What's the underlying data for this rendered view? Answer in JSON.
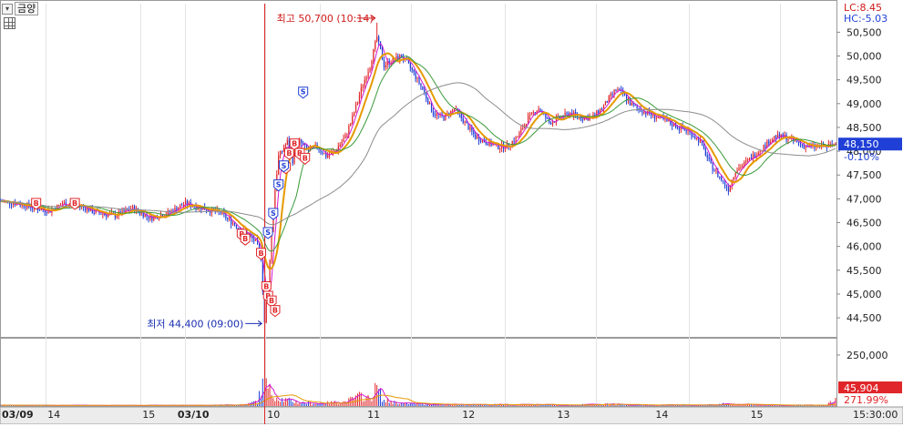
{
  "toolbar": {
    "stock_name": "금양",
    "arrow_icon": "arrow-down-icon",
    "grid_icon": "grid-icon"
  },
  "header_right": {
    "lc": "LC:8.45",
    "hc": "HC:-5.03"
  },
  "chart_data": {
    "type": "candlestick",
    "price_axis": {
      "ticks": [
        "50,500",
        "50,000",
        "49,500",
        "49,000",
        "48,500",
        "48,000",
        "47,500",
        "47,000",
        "46,500",
        "46,000",
        "45,500",
        "45,000",
        "44,500"
      ],
      "tick_values": [
        50500,
        50000,
        49500,
        49000,
        48500,
        48000,
        47500,
        47000,
        46500,
        46000,
        45500,
        45000,
        44500
      ],
      "range": [
        44100,
        51100
      ]
    },
    "volume_axis": {
      "ticks": [
        "250,000"
      ],
      "tick_values": [
        250000
      ],
      "range": [
        0,
        330000
      ]
    },
    "current_price": {
      "value": 48150,
      "label": "48,150",
      "change": "-0.10%"
    },
    "current_volume": {
      "label": "45,904",
      "ratio": "271.99%"
    },
    "high_annotation": {
      "text": "최고 50,700 (10:14)",
      "value": 50700
    },
    "low_annotation": {
      "text": "최저 44,400 (09:00)",
      "value": 44400
    },
    "x_axis": {
      "labels": [
        "03/09",
        "14",
        "15",
        "03/10",
        "10",
        "11",
        "12",
        "13",
        "14",
        "15",
        "15:30:00"
      ]
    },
    "price_anchors": [
      [
        0,
        46950
      ],
      [
        10,
        46900
      ],
      [
        20,
        46800
      ],
      [
        28,
        46750
      ],
      [
        35,
        46900
      ],
      [
        45,
        46850
      ],
      [
        55,
        46700
      ],
      [
        65,
        46650
      ],
      [
        75,
        46800
      ],
      [
        85,
        46600
      ],
      [
        95,
        46700
      ],
      [
        105,
        46900
      ],
      [
        115,
        46800
      ],
      [
        125,
        46700
      ],
      [
        135,
        46400
      ],
      [
        145,
        46100
      ],
      [
        148,
        45800
      ],
      [
        150,
        44400
      ],
      [
        152,
        45200
      ],
      [
        154,
        46300
      ],
      [
        156,
        47200
      ],
      [
        158,
        47900
      ],
      [
        160,
        48000
      ],
      [
        163,
        48200
      ],
      [
        166,
        47800
      ],
      [
        170,
        48200
      ],
      [
        175,
        48000
      ],
      [
        180,
        48100
      ],
      [
        185,
        47900
      ],
      [
        190,
        48000
      ],
      [
        196,
        48300
      ],
      [
        200,
        48700
      ],
      [
        205,
        49300
      ],
      [
        210,
        49800
      ],
      [
        214,
        50400
      ],
      [
        218,
        49800
      ],
      [
        222,
        49900
      ],
      [
        228,
        50000
      ],
      [
        234,
        49700
      ],
      [
        240,
        49300
      ],
      [
        246,
        48800
      ],
      [
        252,
        48700
      ],
      [
        258,
        48900
      ],
      [
        264,
        48600
      ],
      [
        270,
        48300
      ],
      [
        276,
        48200
      ],
      [
        282,
        48100
      ],
      [
        288,
        48100
      ],
      [
        294,
        48300
      ],
      [
        300,
        48700
      ],
      [
        306,
        48900
      ],
      [
        312,
        48600
      ],
      [
        318,
        48700
      ],
      [
        324,
        48800
      ],
      [
        330,
        48700
      ],
      [
        336,
        48700
      ],
      [
        342,
        48900
      ],
      [
        346,
        49100
      ],
      [
        350,
        49300
      ],
      [
        354,
        49200
      ],
      [
        358,
        49000
      ],
      [
        362,
        48900
      ],
      [
        368,
        48800
      ],
      [
        374,
        48700
      ],
      [
        380,
        48600
      ],
      [
        386,
        48500
      ],
      [
        392,
        48400
      ],
      [
        398,
        48200
      ],
      [
        404,
        47700
      ],
      [
        410,
        47400
      ],
      [
        414,
        47200
      ],
      [
        418,
        47600
      ],
      [
        422,
        47700
      ],
      [
        428,
        47900
      ],
      [
        434,
        48100
      ],
      [
        440,
        48300
      ],
      [
        446,
        48300
      ],
      [
        452,
        48200
      ],
      [
        458,
        48100
      ],
      [
        464,
        48100
      ],
      [
        470,
        48100
      ],
      [
        475,
        48150
      ]
    ],
    "volume_anchors": [
      [
        0,
        5000
      ],
      [
        40,
        4000
      ],
      [
        80,
        4000
      ],
      [
        120,
        5000
      ],
      [
        140,
        9000
      ],
      [
        146,
        30000
      ],
      [
        150,
        150000
      ],
      [
        152,
        90000
      ],
      [
        156,
        60000
      ],
      [
        160,
        40000
      ],
      [
        170,
        20000
      ],
      [
        180,
        15000
      ],
      [
        196,
        25000
      ],
      [
        205,
        60000
      ],
      [
        210,
        40000
      ],
      [
        214,
        110000
      ],
      [
        218,
        30000
      ],
      [
        230,
        15000
      ],
      [
        260,
        8000
      ],
      [
        300,
        10000
      ],
      [
        320,
        5000
      ],
      [
        346,
        12000
      ],
      [
        360,
        6000
      ],
      [
        400,
        6000
      ],
      [
        410,
        12000
      ],
      [
        440,
        6000
      ],
      [
        470,
        5000
      ],
      [
        475,
        46000
      ]
    ]
  }
}
